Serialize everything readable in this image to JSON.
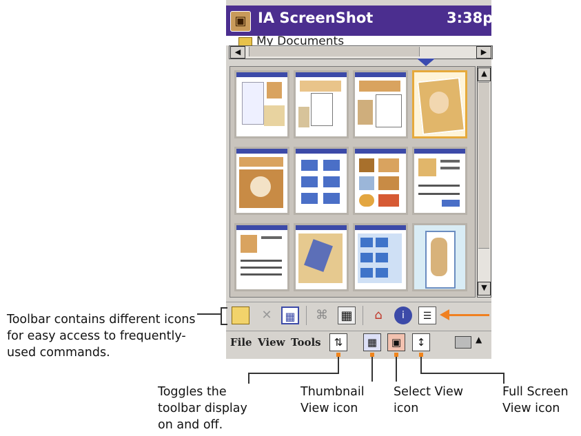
{
  "titlebar": {
    "app_title": "IA ScreenShot",
    "clock": "3:38p",
    "logo_icon": "app-logo-icon"
  },
  "folder": {
    "label": "My Documents",
    "icon": "folder-icon"
  },
  "toolbar": {
    "icons": [
      "new-folder-icon",
      "delete-icon",
      "thumbnail-grid-icon",
      "crop-icon",
      "print-icon",
      "home-icon",
      "info-icon",
      "list-view-icon"
    ]
  },
  "menubar": {
    "file": "File",
    "view": "View",
    "tools": "Tools"
  },
  "annotations": {
    "toolbar": "Toolbar contains different icons for easy access to frequently-used commands.",
    "toggle": "Toggles the toolbar display on and off.",
    "thumbnail": "Thumbnail View icon",
    "select": "Select View icon",
    "fullscreen": "Full Screen View icon"
  },
  "colors": {
    "titlebar": "#4b2e8f",
    "accent_arrow": "#f08020",
    "marker": "#3a4bb0"
  }
}
